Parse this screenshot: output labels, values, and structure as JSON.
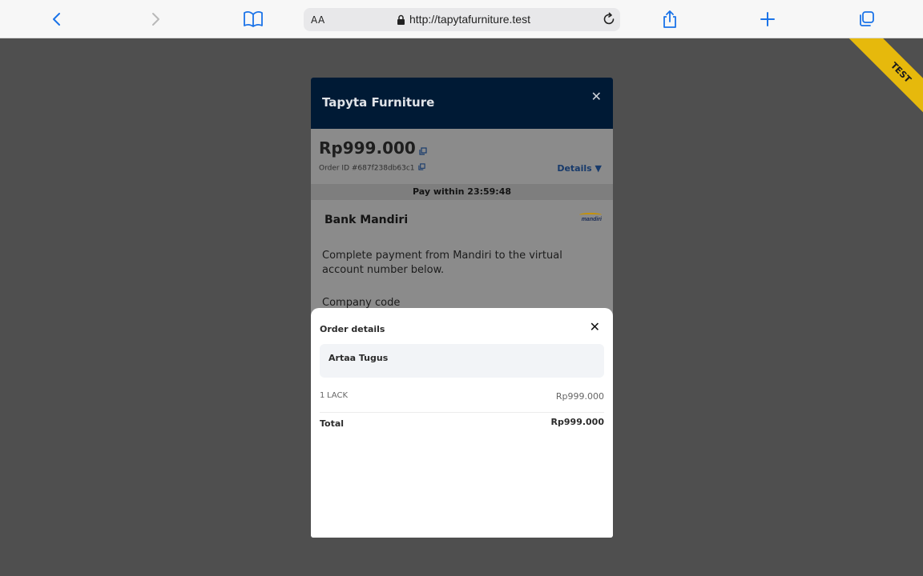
{
  "browser": {
    "reader_label": "AA",
    "url": "http://tapytafurniture.test",
    "accent_color": "#1a73e8"
  },
  "ribbon": {
    "label": "TEST",
    "color": "#e6b90c"
  },
  "payment": {
    "merchant_name": "Tapyta Furniture",
    "amount": "Rp999.000",
    "order_id": "Order ID #687f238db63c1",
    "details_label": "Details",
    "pay_within": "Pay within 23:59:48",
    "bank_name": "Bank Mandiri",
    "bank_logo_text": "mandiri",
    "instruction": "Complete payment from Mandiri to the virtual account number below.",
    "company_code_label": "Company code",
    "header_color": "#001a35"
  },
  "order_details": {
    "title": "Order details",
    "customer_name": "Artaa Tugus",
    "items": [
      {
        "qty": "1",
        "name": "LACK",
        "price": "Rp999.000"
      }
    ],
    "total_label": "Total",
    "total_value": "Rp999.000"
  }
}
